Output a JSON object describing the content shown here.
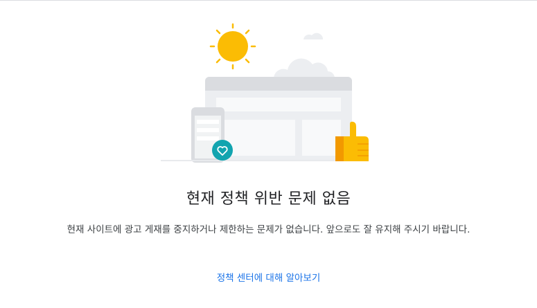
{
  "empty_state": {
    "title": "현재 정책 위반 문제 없음",
    "description": "현재 사이트에 광고 게재를 중지하거나 제한하는 문제가 없습니다. 앞으로도 잘 유지해 주시기 바랍니다.",
    "link_label": "정책 센터에 대해 알아보기"
  },
  "illustration": {
    "icons": [
      "sun-icon",
      "cloud-icon",
      "browser-window-icon",
      "mobile-phone-icon",
      "heart-icon",
      "thumbs-up-icon"
    ],
    "colors": {
      "sun": "#fbbc04",
      "gray_light": "#eceef1",
      "gray_mid": "#dadce0",
      "teal": "#12a4af",
      "link": "#1a73e8"
    }
  }
}
